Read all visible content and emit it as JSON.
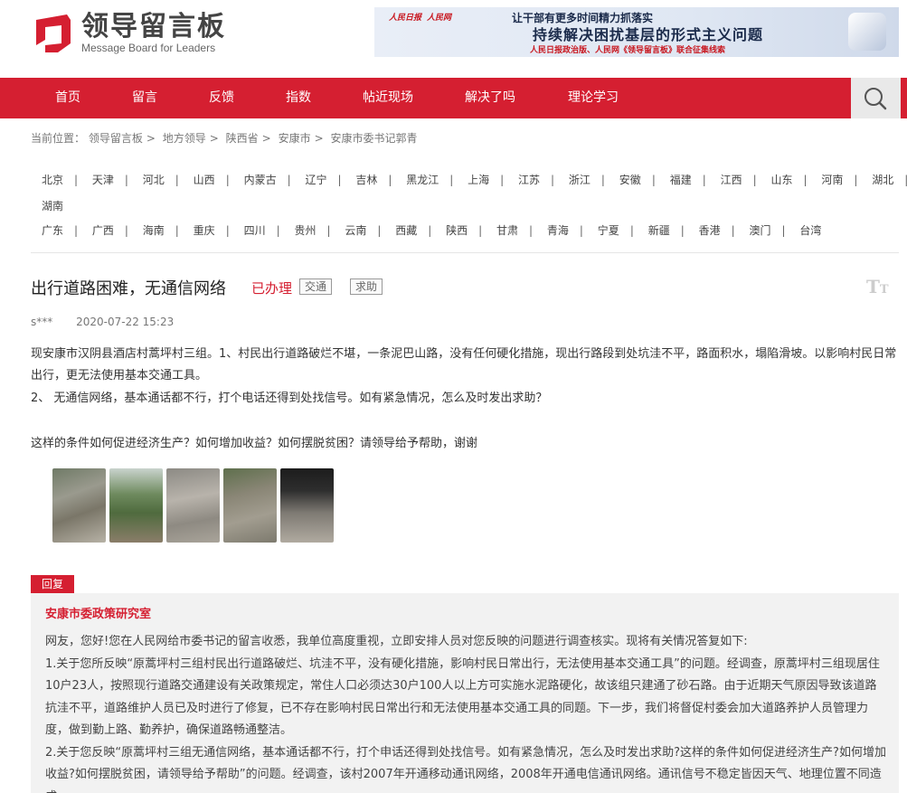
{
  "header": {
    "logo_cn": "领导留言板",
    "logo_en": "Message Board for Leaders",
    "banner": {
      "logo1": "人民日报",
      "logo2": "人民网",
      "line1": "让干部有更多时间精力抓落实",
      "line2": "持续解决困扰基层的形式主义问题",
      "line3": "人民日报政治版、人民网《领导留言板》联合征集线索"
    }
  },
  "nav": {
    "items": [
      "首页",
      "留言",
      "反馈",
      "指数",
      "帖近现场",
      "解决了吗",
      "理论学习"
    ]
  },
  "breadcrumb": {
    "prefix": "当前位置：",
    "items": [
      "领导留言板",
      "地方领导",
      "陕西省",
      "安康市",
      "安康市委书记郭青"
    ]
  },
  "provinces": {
    "row1": [
      "北京",
      "天津",
      "河北",
      "山西",
      "内蒙古",
      "辽宁",
      "吉林",
      "黑龙江",
      "上海",
      "江苏",
      "浙江",
      "安徽",
      "福建",
      "江西",
      "山东",
      "河南",
      "湖北"
    ],
    "row2": [
      "湖南"
    ],
    "row3": [
      "广东",
      "广西",
      "海南",
      "重庆",
      "四川",
      "贵州",
      "云南",
      "西藏",
      "陕西",
      "甘肃",
      "青海",
      "宁夏",
      "新疆",
      "香港",
      "澳门",
      "台湾"
    ]
  },
  "post": {
    "title": "出行道路困难，无通信网络",
    "status": "已办理",
    "tags": [
      "交通",
      "求助"
    ],
    "author": "s***",
    "date": "2020-07-22 15:23",
    "para1": "现安康市汉阴县酒店村蒿坪村三组。1、村民出行道路破烂不堪，一条泥巴山路，没有任何硬化措施，现出行路段到处坑洼不平，路面积水，塌陷滑坡。以影响村民日常出行，更无法使用基本交通工具。",
    "para2": "2、 无通信网络，基本通话都不行，打个电话还得到处找信号。如有紧急情况，怎么及时发出求助？",
    "para3": "这样的条件如何促进经济生产？如何增加收益？如何摆脱贫困？请领导给予帮助，谢谢",
    "photos": [
      "muddy-road-photo-1",
      "mountain-road-photo-2",
      "muddy-road-photo-3",
      "muddy-road-photo-4",
      "muddy-road-photo-5"
    ]
  },
  "reply": {
    "label": "回复",
    "org": "安康市委政策研究室",
    "p1": "网友，您好!您在人民网给市委书记的留言收悉，我单位高度重视，立即安排人员对您反映的问题进行调查核实。现将有关情况答复如下:",
    "p2": "1.关于您所反映“原蒿坪村三组村民出行道路破烂、坑洼不平，没有硬化措施，影响村民日常出行，无法使用基本交通工具”的问题。经调查，原蒿坪村三组现居住10户23人，按照现行道路交通建设有关政策规定，常住人口必须达30户100人以上方可实施水泥路硬化，故该组只建通了砂石路。由于近期天气原因导致该道路抗洼不平，道路维护人员已及时进行了修复，已不存在影响村民日常出行和无法使用基本交通工具的同题。下一步，我们将督促村委会加大道路养护人员管理力度，做到勤上路、勤养护，确保道路畅通整洁。",
    "p3": "2.关于您反映“原蒿坪村三组无通信网络，基本通话都不行，打个申话还得到处找信号。如有紧急情况，怎么及时发出求助?这样的条件如何促进经济生产?如何增加收益?如何摆脱贫困，请领导给予帮助”的问题。经调查，该村2007年开通移动通讯网络，2008年开通电信通讯网络。通讯信号不稳定皆因天气、地理位置不同造成"
  },
  "colors": {
    "brand_red": "#d51f31",
    "nav_search_bg": "#e9e9e9",
    "reply_bg": "#f2f2f2"
  },
  "icons": [
    "logo-mark-icon",
    "search-icon",
    "font-size-icon"
  ]
}
